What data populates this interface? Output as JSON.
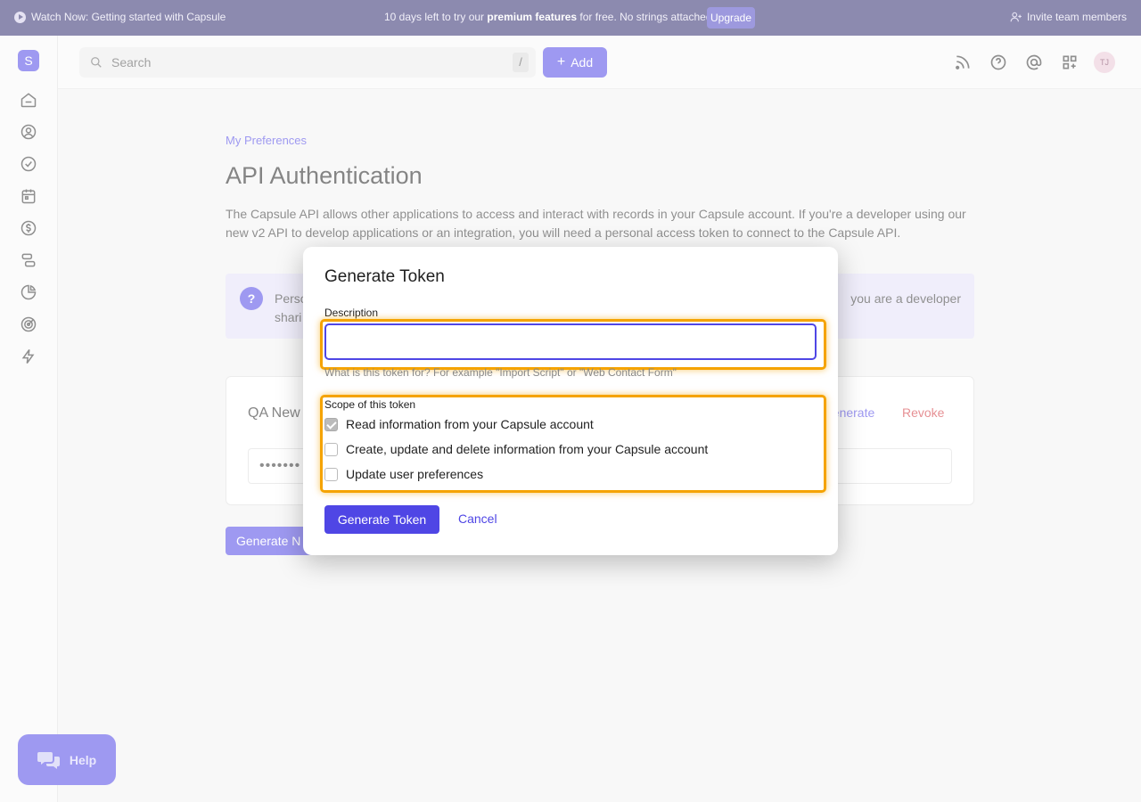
{
  "banner": {
    "watch_label": "Watch Now: Getting started with Capsule",
    "trial_prefix": "10 days left to try our ",
    "trial_bold": "premium features",
    "trial_suffix": " for free. No strings attached.",
    "upgrade_label": "Upgrade",
    "invite_label": "Invite team members"
  },
  "sidebar": {
    "brand_letter": "S"
  },
  "header": {
    "search_placeholder": "Search",
    "search_shortcut": "/",
    "add_label": "Add",
    "avatar_initials": "TJ"
  },
  "page": {
    "breadcrumb": "My Preferences",
    "title": "API Authentication",
    "intro": "The Capsule API allows other applications to access and interact with records in your Capsule account. If you're a developer using our new v2 API to develop applications or an integration, you will need a personal access token to connect to the Capsule API.",
    "info_start": "Perso",
    "info_line2": "shari",
    "info_end": "you are a developer",
    "token_name": "QA New",
    "token_mask": "•••••••",
    "regenerate_label": "generate",
    "revoke_label": "Revoke",
    "generate_new_label": "Generate N"
  },
  "help": {
    "label": "Help"
  },
  "modal": {
    "title": "Generate Token",
    "description_label": "Description",
    "description_value": "",
    "description_hint": "What is this token for? For example \"Import Script\" or \"Web Contact Form\"",
    "scope_label": "Scope of this token",
    "scopes": [
      {
        "label": "Read information from your Capsule account",
        "checked": true
      },
      {
        "label": "Create, update and delete information from your Capsule account",
        "checked": false
      },
      {
        "label": "Update user preferences",
        "checked": false
      }
    ],
    "submit_label": "Generate Token",
    "cancel_label": "Cancel"
  },
  "colors": {
    "accent": "#4f46e5",
    "banner": "#2f2a6e",
    "highlight": "#f5a300",
    "danger": "#d1343b"
  }
}
